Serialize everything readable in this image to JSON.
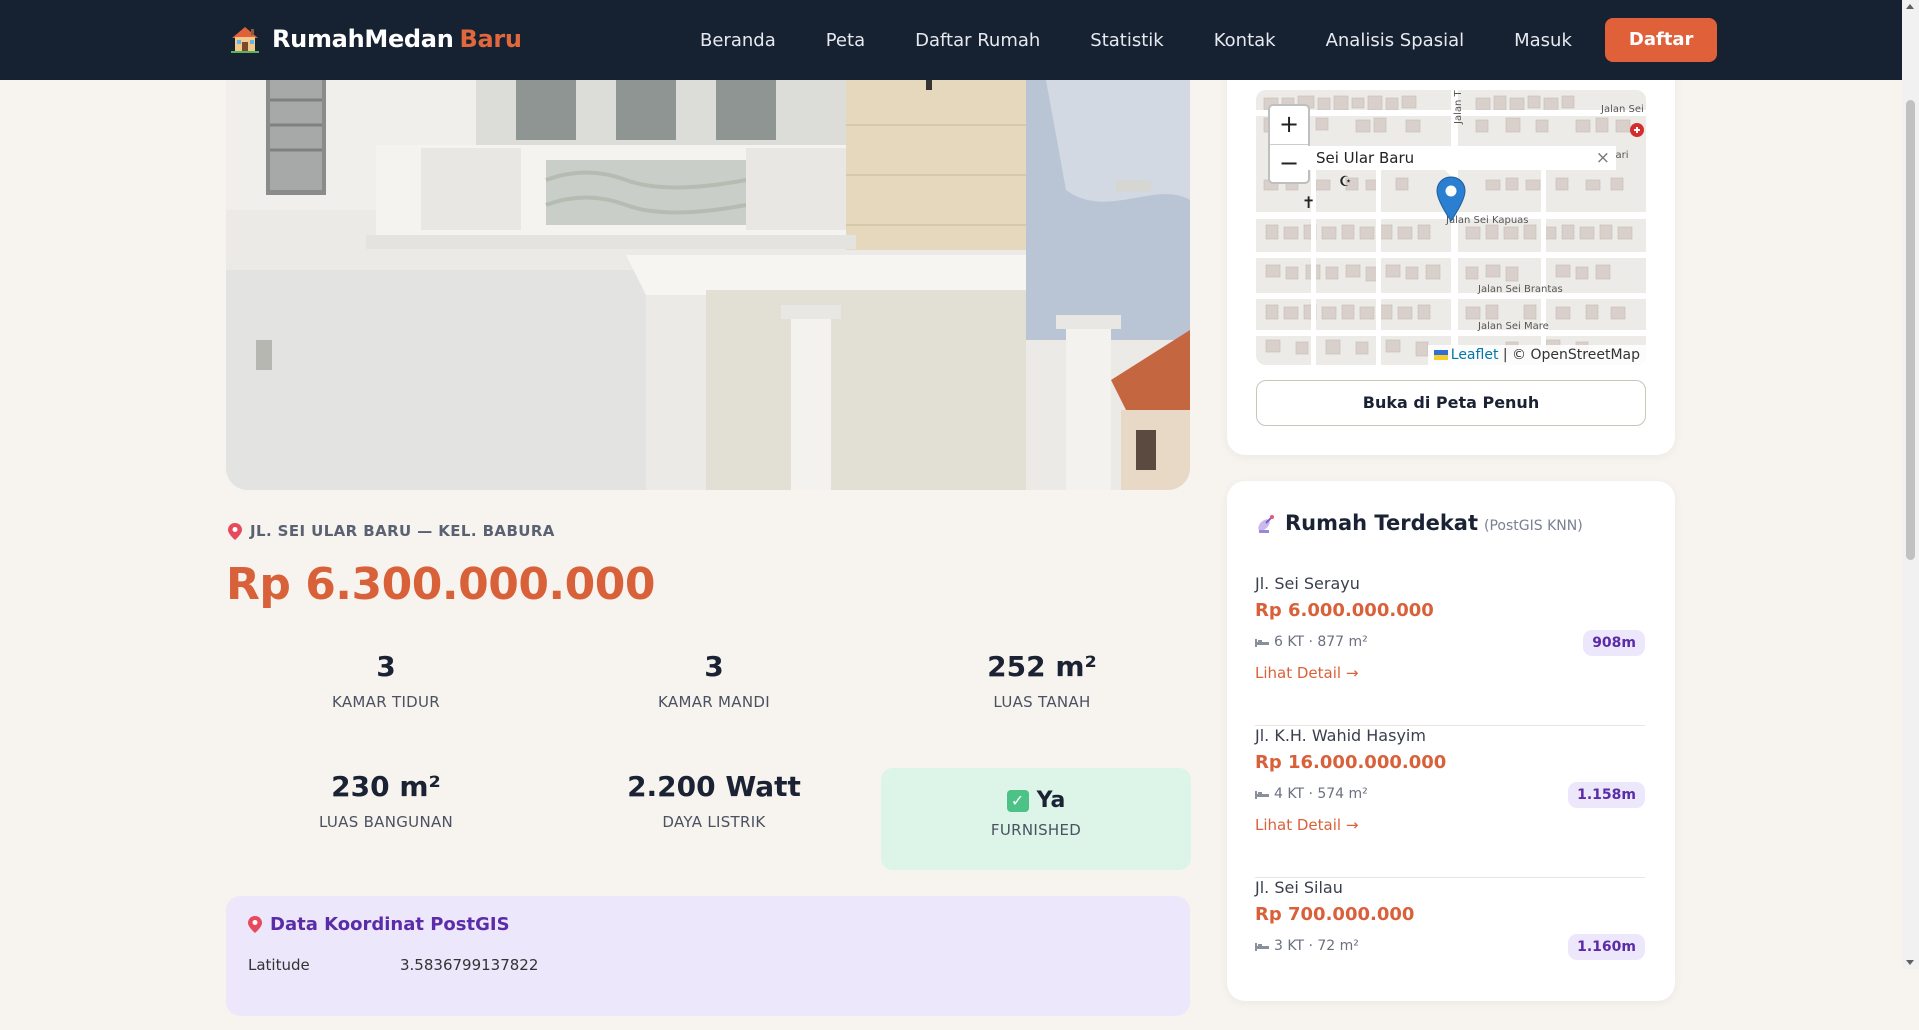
{
  "brand": {
    "name": "RumahMedan",
    "accent": "Baru",
    "icon": "house-icon"
  },
  "nav": {
    "links": [
      "Beranda",
      "Peta",
      "Daftar Rumah",
      "Statistik",
      "Kontak",
      "Analisis Spasial",
      "Masuk"
    ],
    "register_label": "Daftar"
  },
  "property": {
    "address": "JL. SEI ULAR BARU — KEL. BABURA",
    "price": "Rp 6.300.000.000",
    "stats": [
      {
        "value": "3",
        "label": "KAMAR TIDUR"
      },
      {
        "value": "3",
        "label": "KAMAR MANDI"
      },
      {
        "value": "252 m²",
        "label": "LUAS TANAH"
      },
      {
        "value": "230 m²",
        "label": "LUAS BANGUNAN"
      },
      {
        "value": "2.200 Watt",
        "label": "DAYA LISTRIK"
      }
    ],
    "furnished": {
      "value": "Ya",
      "label": "FURNISHED"
    }
  },
  "postgis": {
    "title": "Data Koordinat PostGIS",
    "rows": [
      {
        "label": "Latitude",
        "value": "3.5836799137822"
      }
    ]
  },
  "map": {
    "zoom_in": "+",
    "zoom_out": "−",
    "popup_text": "Sei Ular Baru",
    "popup_close": "×",
    "attribution_link": "Leaflet",
    "attribution_text": "| © OpenStreetMap",
    "street_labels": [
      "Jalan Sei Kapuas",
      "Jalan Sei Brantas",
      "Jalan Sei Mare",
      "Jalan Sei",
      "Hari",
      "Jalan T"
    ],
    "open_full_label": "Buka di Peta Penuh"
  },
  "nearby": {
    "title": "Rumah Terdekat",
    "subtitle": "(PostGIS KNN)",
    "link_label": "Lihat Detail →",
    "items": [
      {
        "street": "Jl. Sei Serayu",
        "price": "Rp 6.000.000.000",
        "meta": "6 KT · 877 m²",
        "distance": "908m"
      },
      {
        "street": "Jl. K.H. Wahid Hasyim",
        "price": "Rp 16.000.000.000",
        "meta": "4 KT · 574 m²",
        "distance": "1.158m"
      },
      {
        "street": "Jl. Sei Silau",
        "price": "Rp 700.000.000",
        "meta": "3 KT · 72 m²",
        "distance": "1.160m"
      }
    ]
  },
  "colors": {
    "accent": "#e0603a",
    "navbar": "#162131",
    "background": "#f7f4ef",
    "purple": "#5b2ca8",
    "green_bg": "#dcf5e8"
  }
}
